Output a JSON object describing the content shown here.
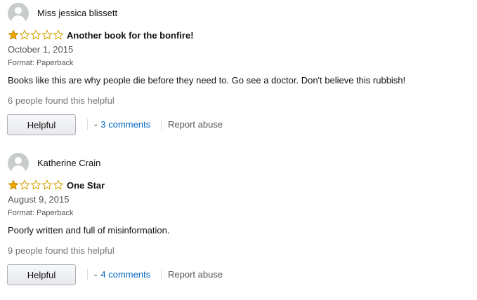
{
  "reviews": [
    {
      "reviewer": "Miss jessica blissett",
      "rating": 1,
      "max_rating": 5,
      "title": "Another book for the bonfire!",
      "date": "October 1, 2015",
      "format": "Format: Paperback",
      "body": "Books like this are why people die before they need to. Go see a doctor. Don't believe this rubbish!",
      "helpful_count": "6 people found this helpful",
      "helpful_label": "Helpful",
      "comments_label": "3 comments",
      "report_label": "Report abuse"
    },
    {
      "reviewer": "Katherine Crain",
      "rating": 1,
      "max_rating": 5,
      "title": "One Star",
      "date": "August 9, 2015",
      "format": "Format: Paperback",
      "body": "Poorly written and full of misinformation.",
      "helpful_count": "9 people found this helpful",
      "helpful_label": "Helpful",
      "comments_label": "4 comments",
      "report_label": "Report abuse"
    }
  ],
  "icons": {
    "avatar": "default-avatar-icon",
    "star_filled": "star-filled-icon",
    "star_empty": "star-empty-icon",
    "chevron": "chevron-down-icon"
  },
  "colors": {
    "star": "#f0a800",
    "link": "#0066c0",
    "muted": "#767676"
  }
}
